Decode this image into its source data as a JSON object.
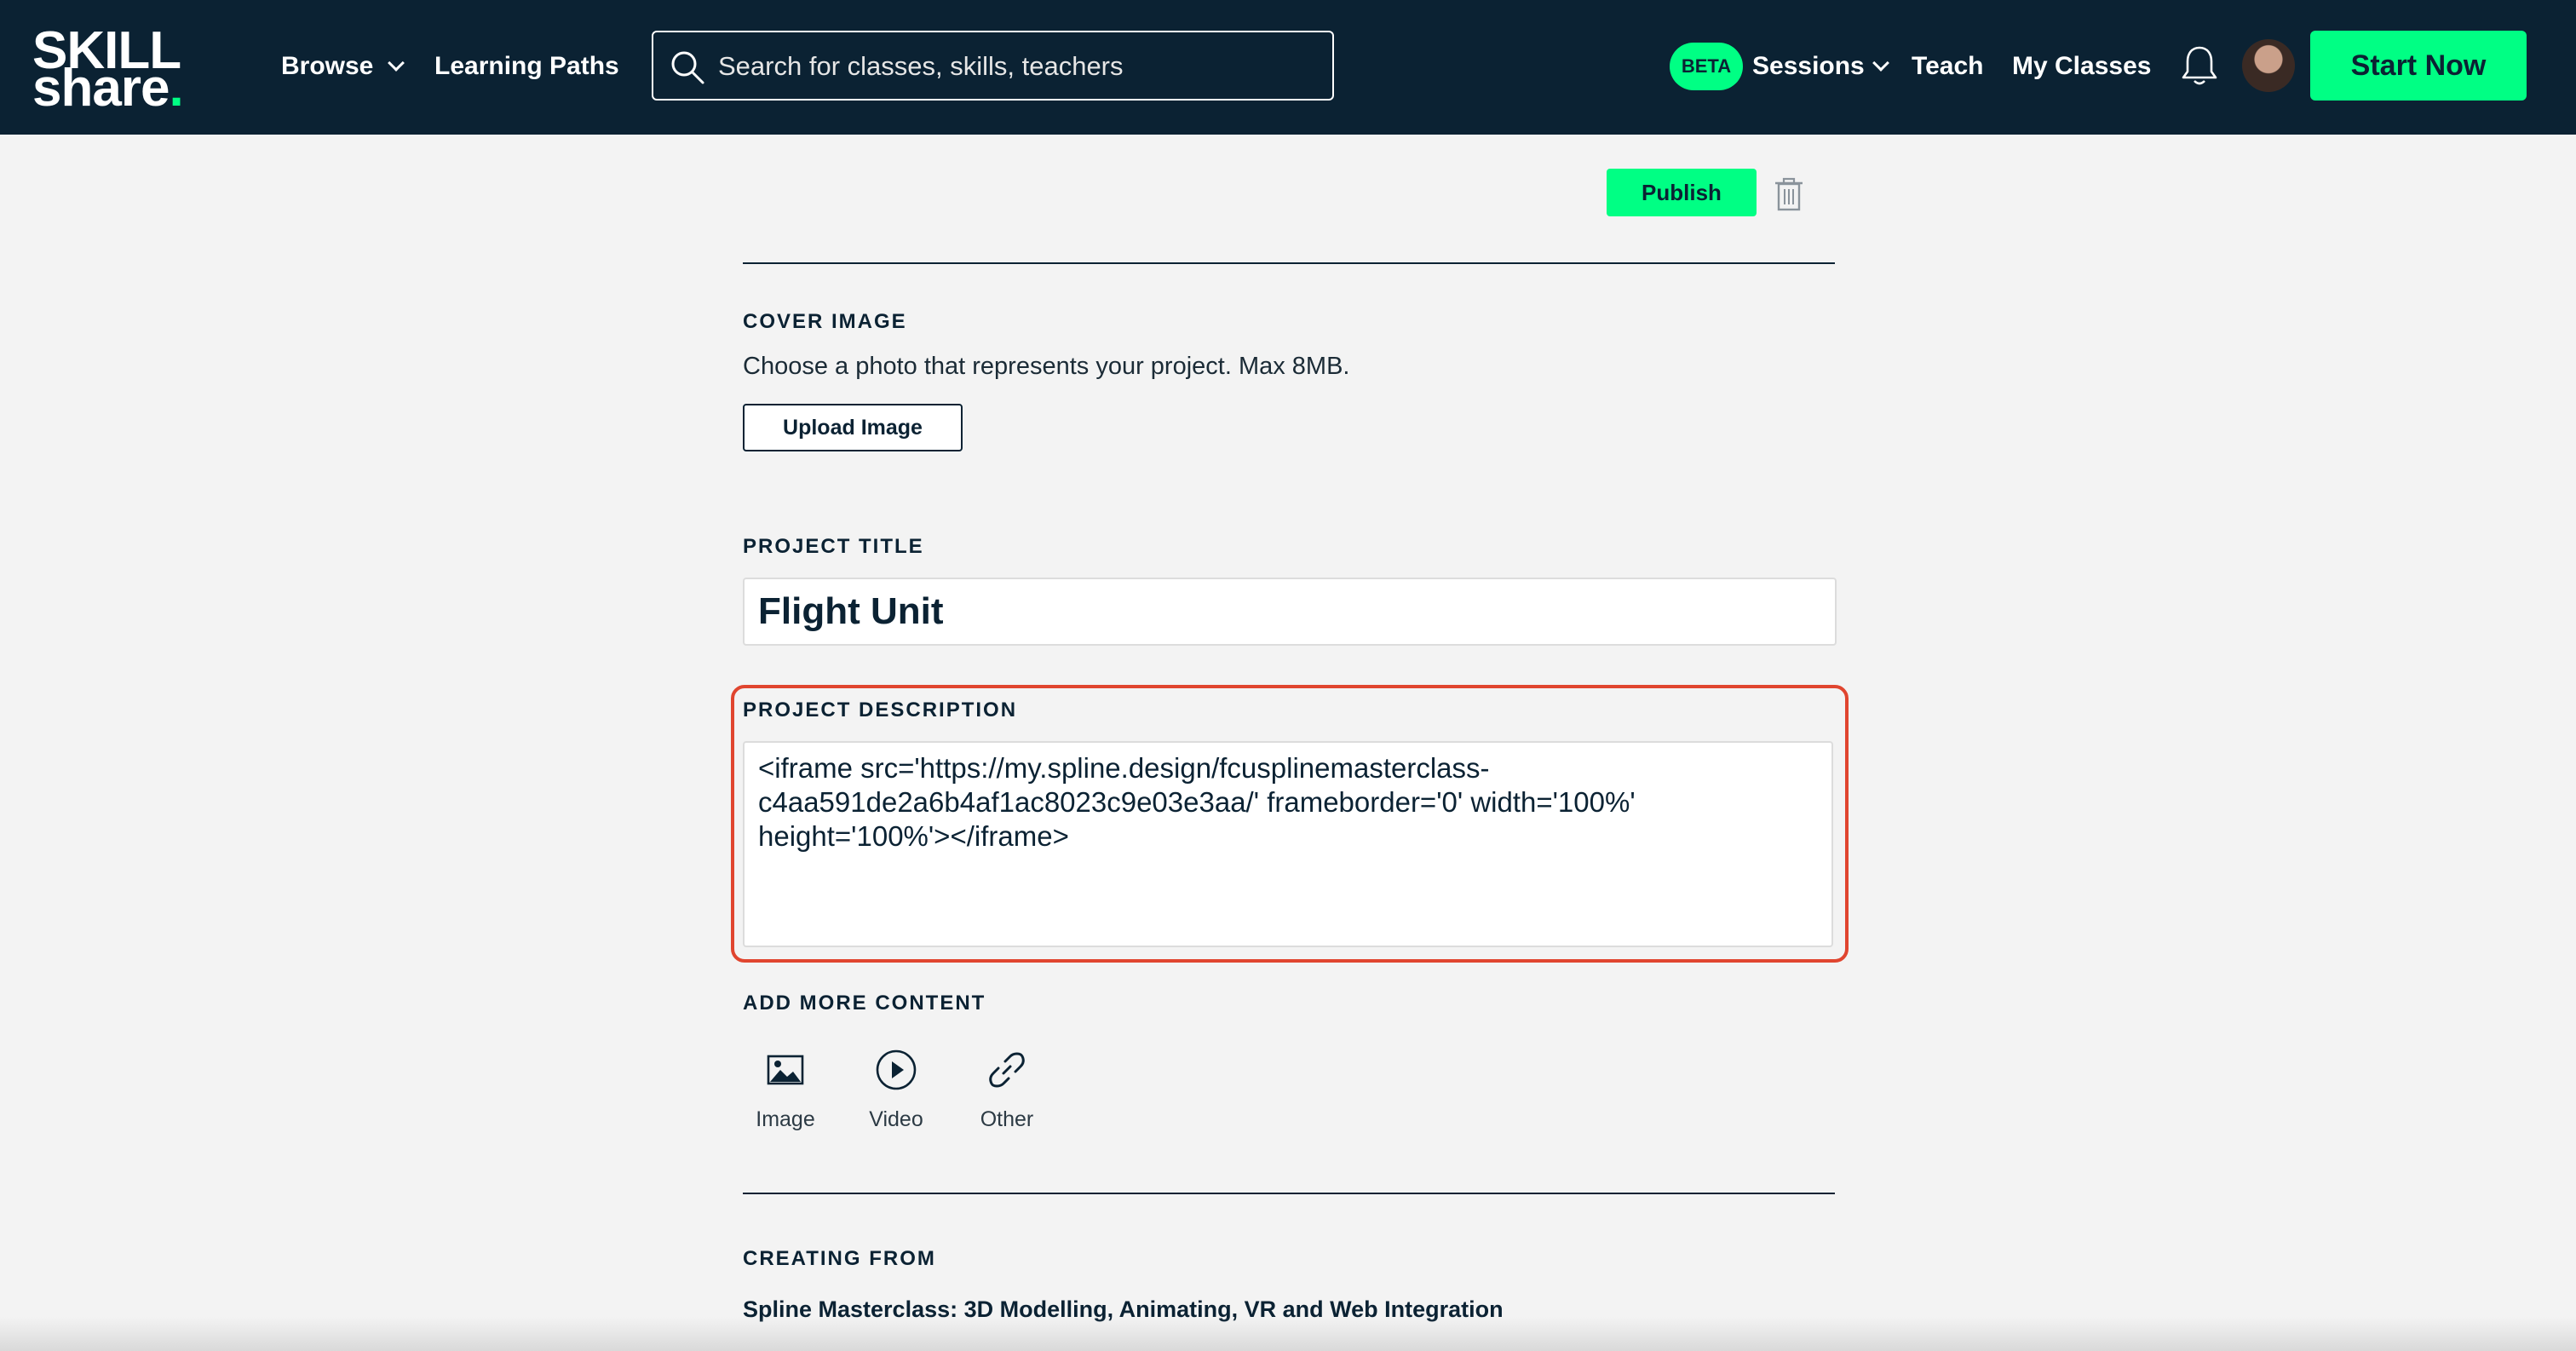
{
  "nav": {
    "logo_line1": "SKILL",
    "logo_line2": "share",
    "logo_dot": ".",
    "browse": "Browse",
    "learning_paths": "Learning Paths",
    "search_placeholder": "Search for classes, skills, teachers",
    "beta_badge": "BETA",
    "sessions": "Sessions",
    "teach": "Teach",
    "my_classes": "My Classes",
    "start_now": "Start Now"
  },
  "toolbar": {
    "publish": "Publish"
  },
  "cover": {
    "label": "COVER IMAGE",
    "helper": "Choose a photo that represents your project. Max 8MB.",
    "upload_button": "Upload Image"
  },
  "project_title": {
    "label": "PROJECT TITLE",
    "value": "Flight Unit"
  },
  "project_description": {
    "label": "PROJECT DESCRIPTION",
    "value": "<iframe src='https://my.spline.design/fcusplinemasterclass-c4aa591de2a6b4af1ac8023c9e03e3aa/' frameborder='0' width='100%' height='100%'></iframe>"
  },
  "add_more": {
    "label": "ADD MORE CONTENT",
    "items": [
      {
        "label": "Image",
        "icon": "image-icon"
      },
      {
        "label": "Video",
        "icon": "play-icon"
      },
      {
        "label": "Other",
        "icon": "link-icon"
      }
    ]
  },
  "creating_from": {
    "label": "CREATING FROM",
    "class_title": "Spline Masterclass: 3D Modelling, Animating, VR and Web Integration"
  },
  "colors": {
    "nav_bg": "#0b2233",
    "accent_green": "#00ff84",
    "highlight_red": "#e0452f"
  }
}
